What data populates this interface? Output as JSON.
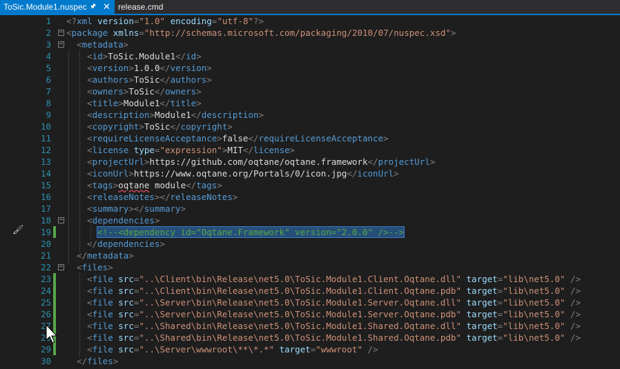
{
  "tabs": [
    {
      "label": "ToSic.Module1.nuspec",
      "active": true,
      "pinned": true
    },
    {
      "label": "release.cmd",
      "active": false
    }
  ],
  "icons": {
    "pin": "pin-icon",
    "close": "close-icon",
    "quick_action": "brush-icon",
    "cursor": "mouse-cursor-icon"
  },
  "colors": {
    "tag": "#569cd6",
    "attribute": "#9cdcfe",
    "string": "#ce9178",
    "comment": "#57a64a",
    "line_number": "#2b91af",
    "selection": "#264f78",
    "accent": "#007acc"
  },
  "editor": {
    "lines": [
      {
        "n": "1",
        "fold": "",
        "changed": false,
        "tokens": [
          [
            "d",
            "<?"
          ],
          [
            "t",
            "xml"
          ],
          [
            "d",
            " "
          ],
          [
            "a",
            "version"
          ],
          [
            "d",
            "="
          ],
          [
            "s",
            "\"1.0\""
          ],
          [
            "d",
            " "
          ],
          [
            "a",
            "encoding"
          ],
          [
            "d",
            "="
          ],
          [
            "s",
            "\"utf-8\""
          ],
          [
            "d",
            "?>"
          ]
        ]
      },
      {
        "n": "2",
        "fold": "−",
        "changed": false,
        "tokens": [
          [
            "d",
            "<"
          ],
          [
            "t",
            "package"
          ],
          [
            "d",
            " "
          ],
          [
            "a",
            "xmlns"
          ],
          [
            "d",
            "="
          ],
          [
            "s",
            "\"http://schemas.microsoft.com/packaging/2010/07/nuspec.xsd\""
          ],
          [
            "d",
            ">"
          ]
        ]
      },
      {
        "n": "3",
        "fold": "−",
        "changed": false,
        "tokens": [
          [
            "d",
            "  <"
          ],
          [
            "t",
            "metadata"
          ],
          [
            "d",
            ">"
          ]
        ]
      },
      {
        "n": "4",
        "fold": "",
        "changed": false,
        "tokens": [
          [
            "d",
            "    <"
          ],
          [
            "t",
            "id"
          ],
          [
            "d",
            ">"
          ],
          [
            "x",
            "ToSic.Module1"
          ],
          [
            "d",
            "</"
          ],
          [
            "t",
            "id"
          ],
          [
            "d",
            ">"
          ]
        ]
      },
      {
        "n": "5",
        "fold": "",
        "changed": false,
        "tokens": [
          [
            "d",
            "    <"
          ],
          [
            "t",
            "version"
          ],
          [
            "d",
            ">"
          ],
          [
            "x",
            "1.0.0"
          ],
          [
            "d",
            "</"
          ],
          [
            "t",
            "version"
          ],
          [
            "d",
            ">"
          ]
        ]
      },
      {
        "n": "6",
        "fold": "",
        "changed": false,
        "tokens": [
          [
            "d",
            "    <"
          ],
          [
            "t",
            "authors"
          ],
          [
            "d",
            ">"
          ],
          [
            "x",
            "ToSic"
          ],
          [
            "d",
            "</"
          ],
          [
            "t",
            "authors"
          ],
          [
            "d",
            ">"
          ]
        ]
      },
      {
        "n": "7",
        "fold": "",
        "changed": false,
        "tokens": [
          [
            "d",
            "    <"
          ],
          [
            "t",
            "owners"
          ],
          [
            "d",
            ">"
          ],
          [
            "x",
            "ToSic"
          ],
          [
            "d",
            "</"
          ],
          [
            "t",
            "owners"
          ],
          [
            "d",
            ">"
          ]
        ]
      },
      {
        "n": "8",
        "fold": "",
        "changed": false,
        "tokens": [
          [
            "d",
            "    <"
          ],
          [
            "t",
            "title"
          ],
          [
            "d",
            ">"
          ],
          [
            "x",
            "Module1"
          ],
          [
            "d",
            "</"
          ],
          [
            "t",
            "title"
          ],
          [
            "d",
            ">"
          ]
        ]
      },
      {
        "n": "9",
        "fold": "",
        "changed": false,
        "tokens": [
          [
            "d",
            "    <"
          ],
          [
            "t",
            "description"
          ],
          [
            "d",
            ">"
          ],
          [
            "x",
            "Module1"
          ],
          [
            "d",
            "</"
          ],
          [
            "t",
            "description"
          ],
          [
            "d",
            ">"
          ]
        ]
      },
      {
        "n": "10",
        "fold": "",
        "changed": false,
        "tokens": [
          [
            "d",
            "    <"
          ],
          [
            "t",
            "copyright"
          ],
          [
            "d",
            ">"
          ],
          [
            "x",
            "ToSic"
          ],
          [
            "d",
            "</"
          ],
          [
            "t",
            "copyright"
          ],
          [
            "d",
            ">"
          ]
        ]
      },
      {
        "n": "11",
        "fold": "",
        "changed": false,
        "tokens": [
          [
            "d",
            "    <"
          ],
          [
            "t",
            "requireLicenseAcceptance"
          ],
          [
            "d",
            ">"
          ],
          [
            "x",
            "false"
          ],
          [
            "d",
            "</"
          ],
          [
            "t",
            "requireLicenseAcceptance"
          ],
          [
            "d",
            ">"
          ]
        ]
      },
      {
        "n": "12",
        "fold": "",
        "changed": false,
        "tokens": [
          [
            "d",
            "    <"
          ],
          [
            "t",
            "license"
          ],
          [
            "d",
            " "
          ],
          [
            "a",
            "type"
          ],
          [
            "d",
            "="
          ],
          [
            "s",
            "\"expression\""
          ],
          [
            "d",
            ">"
          ],
          [
            "x",
            "MIT"
          ],
          [
            "d",
            "</"
          ],
          [
            "t",
            "license"
          ],
          [
            "d",
            ">"
          ]
        ]
      },
      {
        "n": "13",
        "fold": "",
        "changed": false,
        "tokens": [
          [
            "d",
            "    <"
          ],
          [
            "t",
            "projectUrl"
          ],
          [
            "d",
            ">"
          ],
          [
            "x",
            "https://github.com/oqtane/oqtane.framework"
          ],
          [
            "d",
            "</"
          ],
          [
            "t",
            "projectUrl"
          ],
          [
            "d",
            ">"
          ]
        ]
      },
      {
        "n": "14",
        "fold": "",
        "changed": false,
        "tokens": [
          [
            "d",
            "    <"
          ],
          [
            "t",
            "iconUrl"
          ],
          [
            "d",
            ">"
          ],
          [
            "x",
            "https://www.oqtane.org/Portals/0/icon.jpg"
          ],
          [
            "d",
            "</"
          ],
          [
            "t",
            "iconUrl"
          ],
          [
            "d",
            ">"
          ]
        ]
      },
      {
        "n": "15",
        "fold": "",
        "changed": false,
        "tokens": [
          [
            "d",
            "    <"
          ],
          [
            "t",
            "tags"
          ],
          [
            "d",
            ">"
          ],
          [
            "q",
            "oqtane"
          ],
          [
            "x",
            " module"
          ],
          [
            "d",
            "</"
          ],
          [
            "t",
            "tags"
          ],
          [
            "d",
            ">"
          ]
        ]
      },
      {
        "n": "16",
        "fold": "",
        "changed": false,
        "tokens": [
          [
            "d",
            "    <"
          ],
          [
            "t",
            "releaseNotes"
          ],
          [
            "d",
            "></"
          ],
          [
            "t",
            "releaseNotes"
          ],
          [
            "d",
            ">"
          ]
        ]
      },
      {
        "n": "17",
        "fold": "",
        "changed": false,
        "tokens": [
          [
            "d",
            "    <"
          ],
          [
            "t",
            "summary"
          ],
          [
            "d",
            "></"
          ],
          [
            "t",
            "summary"
          ],
          [
            "d",
            ">"
          ]
        ]
      },
      {
        "n": "18",
        "fold": "−",
        "changed": false,
        "tokens": [
          [
            "d",
            "    <"
          ],
          [
            "t",
            "dependencies"
          ],
          [
            "d",
            ">"
          ]
        ]
      },
      {
        "n": "19",
        "fold": "",
        "changed": true,
        "tokens": [
          [
            "d",
            "      "
          ],
          [
            "k",
            "<!--<dependency id=\"Oqtane.Framework\" version=\"2.0.0\" />-->"
          ]
        ]
      },
      {
        "n": "20",
        "fold": "",
        "changed": false,
        "tokens": [
          [
            "d",
            "    </"
          ],
          [
            "t",
            "dependencies"
          ],
          [
            "d",
            ">"
          ]
        ]
      },
      {
        "n": "21",
        "fold": "",
        "changed": false,
        "tokens": [
          [
            "d",
            "  </"
          ],
          [
            "t",
            "metadata"
          ],
          [
            "d",
            ">"
          ]
        ]
      },
      {
        "n": "22",
        "fold": "−",
        "changed": false,
        "tokens": [
          [
            "d",
            "  <"
          ],
          [
            "t",
            "files"
          ],
          [
            "d",
            ">"
          ]
        ]
      },
      {
        "n": "23",
        "fold": "",
        "changed": true,
        "tokens": [
          [
            "d",
            "    <"
          ],
          [
            "t",
            "file"
          ],
          [
            "d",
            " "
          ],
          [
            "a",
            "src"
          ],
          [
            "d",
            "="
          ],
          [
            "s",
            "\"..\\Client\\bin\\Release\\net5.0\\ToSic.Module1.Client.Oqtane.dll\""
          ],
          [
            "d",
            " "
          ],
          [
            "a",
            "target"
          ],
          [
            "d",
            "="
          ],
          [
            "s",
            "\"lib\\net5.0\""
          ],
          [
            "d",
            " />"
          ]
        ]
      },
      {
        "n": "24",
        "fold": "",
        "changed": true,
        "tokens": [
          [
            "d",
            "    <"
          ],
          [
            "t",
            "file"
          ],
          [
            "d",
            " "
          ],
          [
            "a",
            "src"
          ],
          [
            "d",
            "="
          ],
          [
            "s",
            "\"..\\Client\\bin\\Release\\net5.0\\ToSic.Module1.Client.Oqtane.pdb\""
          ],
          [
            "d",
            " "
          ],
          [
            "a",
            "target"
          ],
          [
            "d",
            "="
          ],
          [
            "s",
            "\"lib\\net5.0\""
          ],
          [
            "d",
            " />"
          ]
        ]
      },
      {
        "n": "25",
        "fold": "",
        "changed": true,
        "tokens": [
          [
            "d",
            "    <"
          ],
          [
            "t",
            "file"
          ],
          [
            "d",
            " "
          ],
          [
            "a",
            "src"
          ],
          [
            "d",
            "="
          ],
          [
            "s",
            "\"..\\Server\\bin\\Release\\net5.0\\ToSic.Module1.Server.Oqtane.dll\""
          ],
          [
            "d",
            " "
          ],
          [
            "a",
            "target"
          ],
          [
            "d",
            "="
          ],
          [
            "s",
            "\"lib\\net5.0\""
          ],
          [
            "d",
            " />"
          ]
        ]
      },
      {
        "n": "26",
        "fold": "",
        "changed": true,
        "tokens": [
          [
            "d",
            "    <"
          ],
          [
            "t",
            "file"
          ],
          [
            "d",
            " "
          ],
          [
            "a",
            "src"
          ],
          [
            "d",
            "="
          ],
          [
            "s",
            "\"..\\Server\\bin\\Release\\net5.0\\ToSic.Module1.Server.Oqtane.pdb\""
          ],
          [
            "d",
            " "
          ],
          [
            "a",
            "target"
          ],
          [
            "d",
            "="
          ],
          [
            "s",
            "\"lib\\net5.0\""
          ],
          [
            "d",
            " />"
          ]
        ]
      },
      {
        "n": "27",
        "fold": "",
        "changed": true,
        "tokens": [
          [
            "d",
            "    <"
          ],
          [
            "t",
            "file"
          ],
          [
            "d",
            " "
          ],
          [
            "a",
            "src"
          ],
          [
            "d",
            "="
          ],
          [
            "s",
            "\"..\\Shared\\bin\\Release\\net5.0\\ToSic.Module1.Shared.Oqtane.dll\""
          ],
          [
            "d",
            " "
          ],
          [
            "a",
            "target"
          ],
          [
            "d",
            "="
          ],
          [
            "s",
            "\"lib\\net5.0\""
          ],
          [
            "d",
            " />"
          ]
        ]
      },
      {
        "n": "28",
        "fold": "",
        "changed": true,
        "tokens": [
          [
            "d",
            "    <"
          ],
          [
            "t",
            "file"
          ],
          [
            "d",
            " "
          ],
          [
            "a",
            "src"
          ],
          [
            "d",
            "="
          ],
          [
            "s",
            "\"..\\Shared\\bin\\Release\\net5.0\\ToSic.Module1.Shared.Oqtane.pdb\""
          ],
          [
            "d",
            " "
          ],
          [
            "a",
            "target"
          ],
          [
            "d",
            "="
          ],
          [
            "s",
            "\"lib\\net5.0\""
          ],
          [
            "d",
            " />"
          ]
        ]
      },
      {
        "n": "29",
        "fold": "",
        "changed": true,
        "tokens": [
          [
            "d",
            "    <"
          ],
          [
            "t",
            "file"
          ],
          [
            "d",
            " "
          ],
          [
            "a",
            "src"
          ],
          [
            "d",
            "="
          ],
          [
            "s",
            "\"..\\Server\\wwwroot\\**\\*.*\""
          ],
          [
            "d",
            " "
          ],
          [
            "a",
            "target"
          ],
          [
            "d",
            "="
          ],
          [
            "s",
            "\"wwwroot\""
          ],
          [
            "d",
            " />"
          ]
        ]
      },
      {
        "n": "30",
        "fold": "",
        "changed": false,
        "tokens": [
          [
            "d",
            "  </"
          ],
          [
            "t",
            "files"
          ],
          [
            "d",
            ">"
          ]
        ]
      }
    ]
  }
}
